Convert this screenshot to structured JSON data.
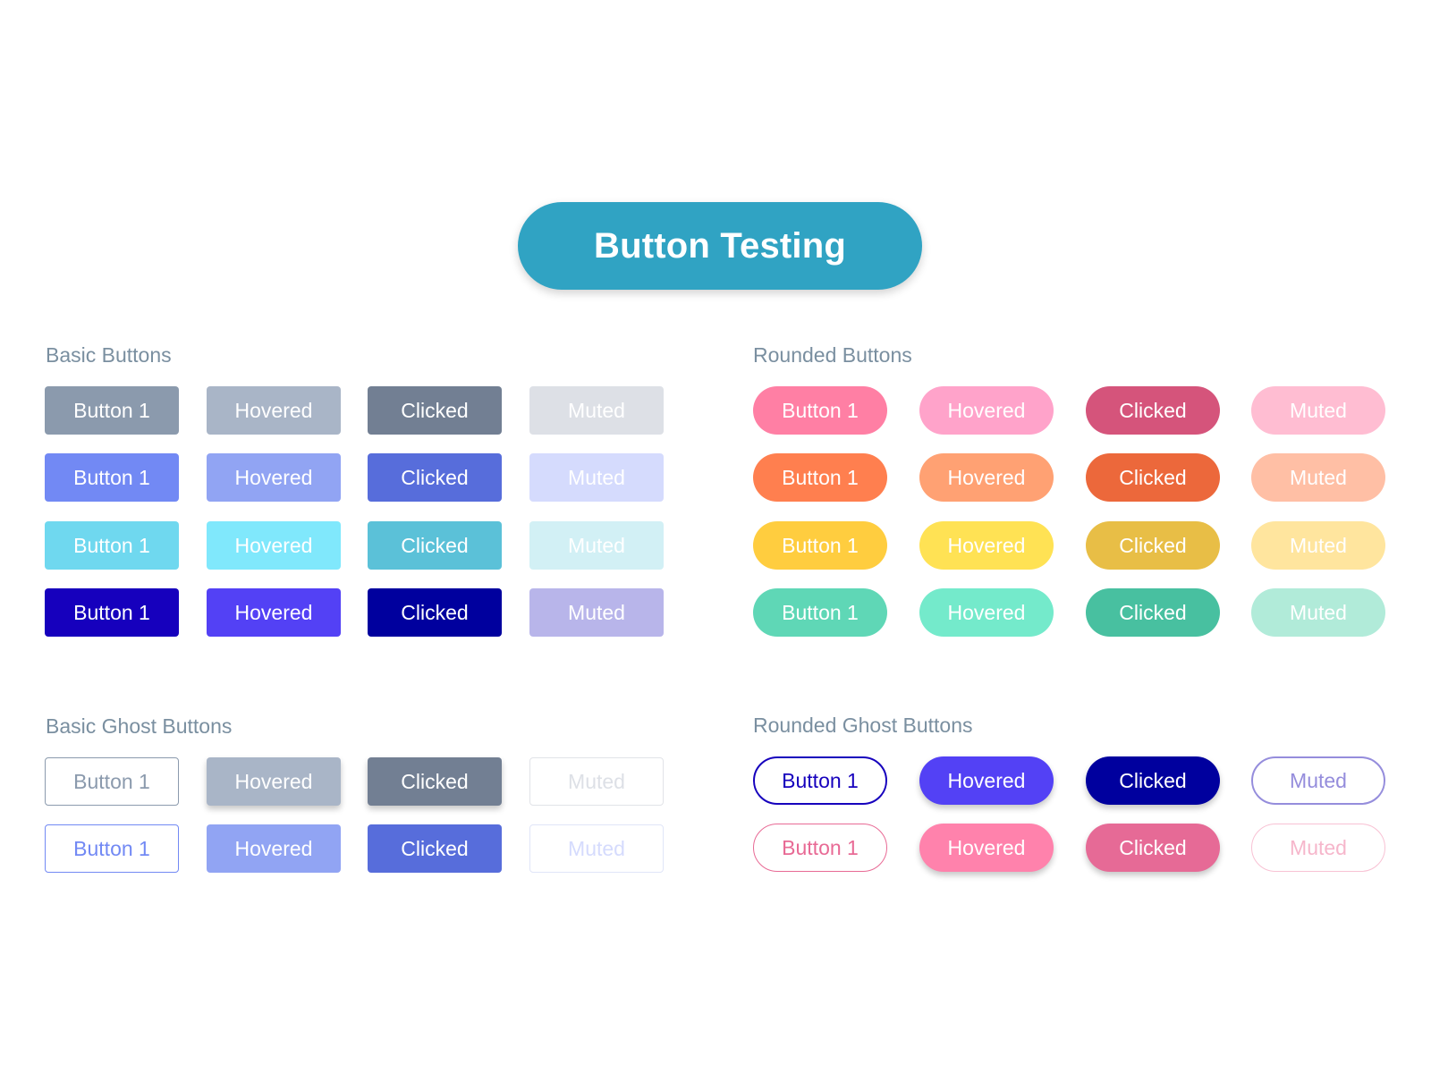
{
  "header": {
    "title": "Button Testing",
    "color": "#30a3c3"
  },
  "sections": {
    "basic": {
      "title": "Basic Buttons",
      "rows": [
        [
          {
            "label": "Button 1",
            "bg": "#8b9aad"
          },
          {
            "label": "Hovered",
            "bg": "#a9b5c7"
          },
          {
            "label": "Clicked",
            "bg": "#727f93"
          },
          {
            "label": "Muted",
            "bg": "#dde0e6"
          }
        ],
        [
          {
            "label": "Button 1",
            "bg": "#7289f4"
          },
          {
            "label": "Hovered",
            "bg": "#91a4f3"
          },
          {
            "label": "Clicked",
            "bg": "#576ddb"
          },
          {
            "label": "Muted",
            "bg": "#d5dbfd"
          }
        ],
        [
          {
            "label": "Button 1",
            "bg": "#6fd8ef"
          },
          {
            "label": "Hovered",
            "bg": "#80e8fc"
          },
          {
            "label": "Clicked",
            "bg": "#5bc1d8"
          },
          {
            "label": "Muted",
            "bg": "#d2f0f5"
          }
        ],
        [
          {
            "label": "Button 1",
            "bg": "#1600bd"
          },
          {
            "label": "Hovered",
            "bg": "#5341f5"
          },
          {
            "label": "Clicked",
            "bg": "#00009e"
          },
          {
            "label": "Muted",
            "bg": "#b8b5ea"
          }
        ]
      ]
    },
    "rounded": {
      "title": "Rounded Buttons",
      "rows": [
        [
          {
            "label": "Button 1",
            "bg": "#ff7fa4"
          },
          {
            "label": "Hovered",
            "bg": "#ffa3ca"
          },
          {
            "label": "Clicked",
            "bg": "#d5547b"
          },
          {
            "label": "Muted",
            "bg": "#ffbdd2"
          }
        ],
        [
          {
            "label": "Button 1",
            "bg": "#ff7f4f"
          },
          {
            "label": "Hovered",
            "bg": "#ffa173"
          },
          {
            "label": "Clicked",
            "bg": "#ec683b"
          },
          {
            "label": "Muted",
            "bg": "#ffbfa5"
          }
        ],
        [
          {
            "label": "Button 1",
            "bg": "#ffcd3f"
          },
          {
            "label": "Hovered",
            "bg": "#ffe254"
          },
          {
            "label": "Clicked",
            "bg": "#e8be46"
          },
          {
            "label": "Muted",
            "bg": "#ffe59e"
          }
        ],
        [
          {
            "label": "Button 1",
            "bg": "#5fd7b6"
          },
          {
            "label": "Hovered",
            "bg": "#74eacb"
          },
          {
            "label": "Clicked",
            "bg": "#48c0a0"
          },
          {
            "label": "Muted",
            "bg": "#b1ebd9"
          }
        ]
      ]
    },
    "basic_ghost": {
      "title": "Basic Ghost Buttons",
      "rows": [
        [
          {
            "label": "Button 1",
            "bg": "#ffffff",
            "border": "#8b9aad",
            "color": "#8b9aad"
          },
          {
            "label": "Hovered",
            "bg": "#a9b5c7",
            "shadow": true
          },
          {
            "label": "Clicked",
            "bg": "#727f93",
            "shadow": true
          },
          {
            "label": "Muted",
            "bg": "#ffffff",
            "border": "#e1e3e8",
            "color": "#dde0e6"
          }
        ],
        [
          {
            "label": "Button 1",
            "bg": "#ffffff",
            "border": "#7289f4",
            "color": "#7289f4"
          },
          {
            "label": "Hovered",
            "bg": "#91a4f3"
          },
          {
            "label": "Clicked",
            "bg": "#576ddb"
          },
          {
            "label": "Muted",
            "bg": "#ffffff",
            "border": "#e0e5f8",
            "color": "#d5dbfd"
          }
        ]
      ]
    },
    "rounded_ghost": {
      "title": "Rounded Ghost Buttons",
      "rows": [
        [
          {
            "label": "Button 1",
            "bg": "#ffffff",
            "border": "#1600bd",
            "color": "#1600bd",
            "bw": 2
          },
          {
            "label": "Hovered",
            "bg": "#5341f5",
            "shadow": true
          },
          {
            "label": "Clicked",
            "bg": "#00009e",
            "shadow": true
          },
          {
            "label": "Muted",
            "bg": "#ffffff",
            "border": "#958ddc",
            "color": "#958ddc",
            "bw": 2
          }
        ],
        [
          {
            "label": "Button 1",
            "bg": "#ffffff",
            "border": "#e86a95",
            "color": "#e86a95"
          },
          {
            "label": "Hovered",
            "bg": "#ff82ac",
            "shadow": true
          },
          {
            "label": "Clicked",
            "bg": "#e66a96",
            "shadow": true
          },
          {
            "label": "Muted",
            "bg": "#ffffff",
            "border": "#f8c2d4",
            "color": "#f6b6cb"
          }
        ]
      ]
    }
  }
}
